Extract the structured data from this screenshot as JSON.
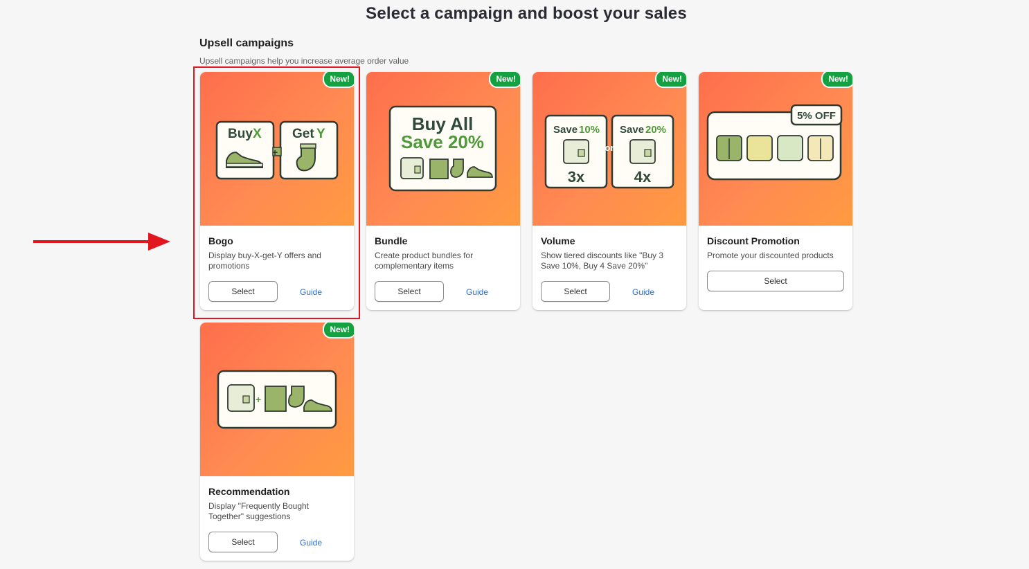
{
  "page_title": "Select a campaign and boost your sales",
  "section": {
    "title": "Upsell campaigns",
    "subtitle": "Upsell campaigns help you increase average order value"
  },
  "badge_label": "New!",
  "select_label": "Select",
  "guide_label": "Guide",
  "cards": [
    {
      "title": "Bogo",
      "description": "Display buy-X-get-Y offers and promotions",
      "art": {
        "left_word": "Buy",
        "left_letter": "X",
        "right_word": "Get",
        "right_letter": "Y",
        "plus": "+"
      }
    },
    {
      "title": "Bundle",
      "description": "Create product bundles for complementary items",
      "art": {
        "line1": "Buy All",
        "line2": "Save 20%"
      }
    },
    {
      "title": "Volume",
      "description": "Show tiered discounts like \"Buy 3 Save 10%, Buy 4 Save 20%\"",
      "art": {
        "save_word": "Save",
        "pct1": "10%",
        "pct2": "20%",
        "qty1": "3x",
        "qty2": "4x",
        "or": "or"
      }
    },
    {
      "title": "Discount Promotion",
      "description": "Promote your discounted products",
      "art": {
        "tag": "5% OFF"
      }
    },
    {
      "title": "Recommendation",
      "description": "Display \"Frequently Bought Together\" suggestions",
      "art": {
        "plus": "+"
      }
    }
  ],
  "colors": {
    "accent_green": "#15a142",
    "card_gradient_start": "#fe6e4c",
    "card_gradient_end": "#ff9b40",
    "highlight": "#e2161e",
    "link": "#2c6ecb",
    "art_dark_green": "#2f4a36",
    "art_light_green": "#4e9a3a"
  }
}
